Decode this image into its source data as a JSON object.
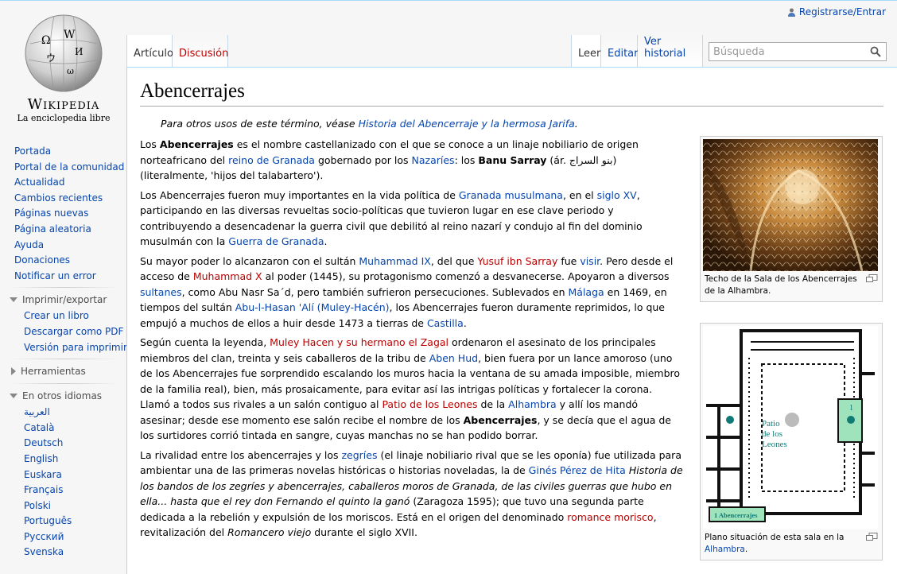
{
  "logo": {
    "wordmark": "Wikipedia",
    "tagline": "La enciclopedia libre"
  },
  "personal": {
    "login_label": "Registrarse/Entrar"
  },
  "tabs": {
    "articulo": "Artículo",
    "discusion": "Discusión",
    "leer": "Leer",
    "editar": "Editar",
    "historial": "Ver historial"
  },
  "search": {
    "placeholder": "Búsqueda"
  },
  "sidebar": {
    "navigation": [
      "Portada",
      "Portal de la comunidad",
      "Actualidad",
      "Cambios recientes",
      "Páginas nuevas",
      "Página aleatoria",
      "Ayuda",
      "Donaciones",
      "Notificar un error"
    ],
    "print_heading": "Imprimir/exportar",
    "print_items": [
      "Crear un libro",
      "Descargar como PDF",
      "Versión para imprimir"
    ],
    "tools_heading": "Herramientas",
    "languages_heading": "En otros idiomas",
    "languages": [
      "العربية",
      "Català",
      "Deutsch",
      "English",
      "Euskara",
      "Français",
      "Polski",
      "Português",
      "Русский",
      "Svenska"
    ]
  },
  "article": {
    "title": "Abencerrajes",
    "hatnote_prefix": "Para otros usos de este término, véase ",
    "hatnote_link": "Historia del Abencerraje y la hermosa Jarifa",
    "hatnote_suffix": "."
  },
  "figures": [
    {
      "caption": "Techo de la Sala de los Abencerrajes de la Alhambra."
    },
    {
      "caption_prefix": "Plano situación de esta sala en la ",
      "caption_link": "Alhambra",
      "caption_suffix": ".",
      "map_label_patio": "Patio de los Leones",
      "map_label_room": "1 Abencerrajes",
      "map_number": "1"
    }
  ],
  "paragraphs": [
    [
      {
        "t": "Los "
      },
      {
        "t": "Abencerrajes",
        "s": "b"
      },
      {
        "t": " es el nombre castellanizado con el que se conoce a un linaje nobiliario de origen norteafricano del "
      },
      {
        "t": "reino de Granada",
        "s": "a"
      },
      {
        "t": " gobernado por los "
      },
      {
        "t": "Nazaríes",
        "s": "a"
      },
      {
        "t": ": los "
      },
      {
        "t": "Banu Sarray",
        "s": "b"
      },
      {
        "t": " (ár. بنو السراج) (literalmente, 'hijos del talabartero')."
      }
    ],
    [
      {
        "t": "Los Abencerrajes fueron muy importantes en la vida política de "
      },
      {
        "t": "Granada musulmana",
        "s": "a"
      },
      {
        "t": ", en el "
      },
      {
        "t": "siglo XV",
        "s": "a"
      },
      {
        "t": ", participando en las diversas revueltas socio-políticas que tuvieron lugar en ese clave periodo y contribuyendo a desencadenar la guerra civil que debilitó al reino nazarí y condujo al fin del dominio musulmán con la "
      },
      {
        "t": "Guerra de Granada",
        "s": "a"
      },
      {
        "t": "."
      }
    ],
    [
      {
        "t": "Su mayor poder lo alcanzaron con el sultán "
      },
      {
        "t": "Muhammad IX",
        "s": "a"
      },
      {
        "t": ", del que "
      },
      {
        "t": "Yusuf ibn Sarray",
        "s": "r"
      },
      {
        "t": " fue "
      },
      {
        "t": "visir",
        "s": "a"
      },
      {
        "t": ". Pero desde el acceso de "
      },
      {
        "t": "Muhammad X",
        "s": "r"
      },
      {
        "t": " al poder (1445), su protagonismo comenzó a desvanecerse. Apoyaron a diversos "
      },
      {
        "t": "sultanes",
        "s": "a"
      },
      {
        "t": ", como Abu Nasr Sa´d, pero también sufrieron persecuciones. Sublevados en "
      },
      {
        "t": "Málaga",
        "s": "a"
      },
      {
        "t": " en 1469, en tiempos del sultán "
      },
      {
        "t": "Abu-l-Hasan 'Alí (Muley-Hacén)",
        "s": "a"
      },
      {
        "t": ", los Abencerrajes fueron duramente reprimidos, lo que empujó a muchos de ellos a huir desde 1473 a tierras de "
      },
      {
        "t": "Castilla",
        "s": "a"
      },
      {
        "t": "."
      }
    ],
    [
      {
        "t": "Según cuenta la leyenda, "
      },
      {
        "t": "Muley Hacen y su hermano el Zagal",
        "s": "r"
      },
      {
        "t": " ordenaron el asesinato de los principales miembros del clan, treinta y seis caballeros de la tribu de "
      },
      {
        "t": "Aben Hud",
        "s": "a"
      },
      {
        "t": ", bien fuera por un lance amoroso (uno de los Abencerrajes fue sorprendido escalando los muros hacia la ventana de su amada imposible, miembro de la familia real), bien, más prosaicamente, para evitar así las intrigas políticas y fortalecer la corona. Llamó a todos sus rivales a un salón contiguo al "
      },
      {
        "t": "Patio de los Leones",
        "s": "r"
      },
      {
        "t": " de la "
      },
      {
        "t": "Alhambra",
        "s": "a"
      },
      {
        "t": " y allí los mandó asesinar; desde ese momento ese salón recibe el nombre de los "
      },
      {
        "t": "Abencerrajes",
        "s": "b"
      },
      {
        "t": ", y se decía que el agua de los surtidores corrió tintada en sangre, cuyas manchas no se han podido borrar."
      }
    ],
    [
      {
        "t": "La rivalidad entre los abencerrajes y los "
      },
      {
        "t": "zegríes",
        "s": "a"
      },
      {
        "t": " (el linaje nobiliario rival que se les oponía) fue utilizada para ambientar una de las primeras novelas históricas o historias noveladas, la de "
      },
      {
        "t": "Ginés Pérez de Hita",
        "s": "a"
      },
      {
        "t": " "
      },
      {
        "t": "Historia de los bandos de los zegríes y abencerrajes, caballeros moros de Granada, de las civiles guerras que hubo en ella... hasta que el rey don Fernando el quinto la ganó",
        "s": "i"
      },
      {
        "t": " (Zaragoza 1595); que tuvo una segunda parte dedicada a la rebelión y expulsión de los moriscos. Está en el origen del denominado "
      },
      {
        "t": "romance morisco",
        "s": "r"
      },
      {
        "t": ", revitalización del "
      },
      {
        "t": "Romancero viejo",
        "s": "i"
      },
      {
        "t": " durante el siglo XVII."
      }
    ]
  ]
}
